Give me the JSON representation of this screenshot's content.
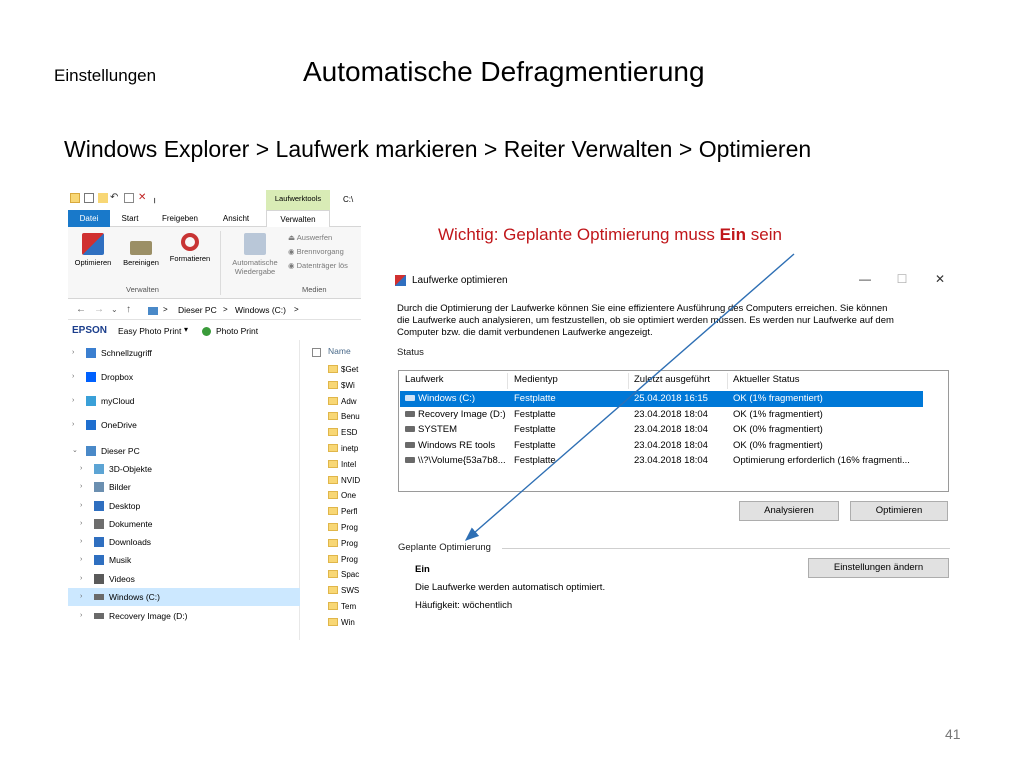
{
  "slide": {
    "category": "Einstellungen",
    "title": "Automatische Defragmentierung",
    "subtitle": "Windows Explorer > Laufwerk markieren > Reiter Verwalten > Optimieren",
    "note_prefix": "Wichtig: Geplante Optimierung muss ",
    "note_bold": "Ein",
    "note_suffix": " sein",
    "page_number": "41"
  },
  "explorer": {
    "tool_tab_title": "Laufwerktools",
    "path_top": "C:\\",
    "tabs": [
      "Datei",
      "Start",
      "Freigeben",
      "Ansicht",
      "Verwalten"
    ],
    "ribbon": {
      "buttons": [
        "Optimieren",
        "Bereinigen",
        "Formatieren"
      ],
      "autoplay": [
        "Automatische",
        "Wiedergabe"
      ],
      "small": [
        "Auswerfen",
        "Brennvorgang",
        "Datenträger lös"
      ],
      "group_manage": "Verwalten",
      "group_media": "Medien"
    },
    "address": [
      "Dieser PC",
      ">",
      "Windows (C:)",
      ">"
    ],
    "epson_brand": "EPSON",
    "epson_items": [
      "Easy Photo Print",
      "Photo Print"
    ],
    "column_name": "Name",
    "nav": [
      {
        "label": "Schnellzugriff",
        "icon": "star-icon"
      },
      {
        "label": "Dropbox",
        "icon": "dropbox-icon"
      },
      {
        "label": "myCloud",
        "icon": "cloud-icon"
      },
      {
        "label": "OneDrive",
        "icon": "onedrive-icon"
      },
      {
        "label": "Dieser PC",
        "icon": "computer-icon"
      },
      {
        "label": "3D-Objekte",
        "icon": "cube-icon"
      },
      {
        "label": "Bilder",
        "icon": "pictures-icon"
      },
      {
        "label": "Desktop",
        "icon": "desktop-icon"
      },
      {
        "label": "Dokumente",
        "icon": "documents-icon"
      },
      {
        "label": "Downloads",
        "icon": "download-icon"
      },
      {
        "label": "Musik",
        "icon": "music-icon"
      },
      {
        "label": "Videos",
        "icon": "video-icon"
      },
      {
        "label": "Windows (C:)",
        "icon": "drive-icon"
      },
      {
        "label": "Recovery Image (D:)",
        "icon": "drive-icon"
      }
    ],
    "files": [
      "$Get",
      "$Wi",
      "Adw",
      "Benu",
      "ESD",
      "inetp",
      "Intel",
      "NVID",
      "One",
      "Perfl",
      "Prog",
      "Prog",
      "Prog",
      "Spac",
      "SWS",
      "Tem",
      "Win"
    ]
  },
  "dialog": {
    "title": "Laufwerke optimieren",
    "description": [
      "Durch die Optimierung der Laufwerke können Sie eine effizientere Ausführung des Computers erreichen. Sie können",
      "die Laufwerke auch analysieren, um festzustellen, ob sie optimiert werden müssen. Es werden nur Laufwerke auf dem",
      "Computer bzw. die damit verbundenen Laufwerke angezeigt."
    ],
    "status_label": "Status",
    "columns": [
      "Laufwerk",
      "Medientyp",
      "Zuletzt ausgeführt",
      "Aktueller Status"
    ],
    "rows": [
      [
        "Windows (C:)",
        "Festplatte",
        "25.04.2018 16:15",
        "OK (1% fragmentiert)"
      ],
      [
        "Recovery Image (D:)",
        "Festplatte",
        "23.04.2018 18:04",
        "OK (1% fragmentiert)"
      ],
      [
        "SYSTEM",
        "Festplatte",
        "23.04.2018 18:04",
        "OK (0% fragmentiert)"
      ],
      [
        "Windows RE tools",
        "Festplatte",
        "23.04.2018 18:04",
        "OK (0% fragmentiert)"
      ],
      [
        "\\\\?\\Volume{53a7b8...",
        "Festplatte",
        "23.04.2018 18:04",
        "Optimierung erforderlich (16% fragmenti..."
      ]
    ],
    "btn_analyze": "Analysieren",
    "btn_optimize": "Optimieren",
    "scheduled_label": "Geplante Optimierung",
    "scheduled_state": "Ein",
    "scheduled_desc": "Die Laufwerke werden automatisch optimiert.",
    "scheduled_freq": "Häufigkeit: wöchentlich",
    "btn_change": "Einstellungen ändern",
    "selection_color": "#0078d7"
  },
  "colors": {
    "accent_red": "#c0161a",
    "arrow_blue": "#2e6fb4"
  }
}
